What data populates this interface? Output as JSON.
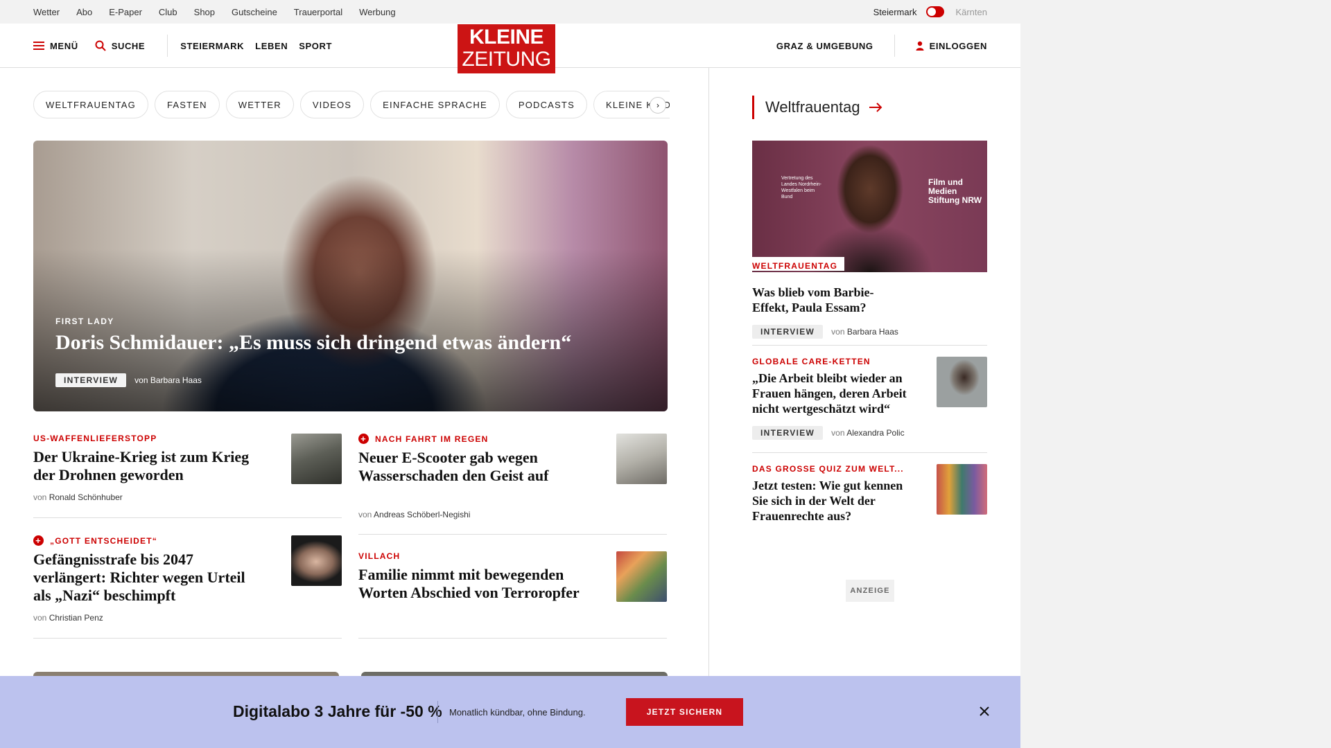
{
  "topbar": {
    "links": [
      "Wetter",
      "Abo",
      "E-Paper",
      "Club",
      "Shop",
      "Gutscheine",
      "Trauerportal",
      "Werbung"
    ],
    "region_active": "Steiermark",
    "region_inactive": "Kärnten"
  },
  "header": {
    "menu_label": "MENÜ",
    "search_label": "SUCHE",
    "nav": [
      "STEIERMARK",
      "LEBEN",
      "SPORT"
    ],
    "logo_line1": "KLEINE",
    "logo_line2": "ZEITUNG",
    "region_link": "GRAZ & UMGEBUNG",
    "login_label": "EINLOGGEN"
  },
  "pills": [
    "WELTFRAUENTAG",
    "FASTEN",
    "WETTER",
    "VIDEOS",
    "EINFACHE SPRACHE",
    "PODCASTS",
    "KLEINE KINDERZE"
  ],
  "hero": {
    "kicker": "FIRST LADY",
    "title": "Doris Schmidauer: „Es muss sich dringend etwas ändern“",
    "badge": "INTERVIEW",
    "by_prefix": "von",
    "author": "Barbara Haas"
  },
  "teasers": [
    {
      "kicker": "US-WAFFENLIEFERSTOPP",
      "title": "Der Ukraine-Krieg ist zum Krieg der Drohnen geworden",
      "by_prefix": "von",
      "author": "Ronald Schönhuber",
      "plus": false
    },
    {
      "kicker": "NACH FAHRT IM REGEN",
      "title": "Neuer E-Scooter gab wegen Wasserschaden den Geist auf",
      "by_prefix": "von",
      "author": "Andreas Schöberl-Negishi",
      "plus": true
    },
    {
      "kicker": "„GOTT ENTSCHEIDET“",
      "title": "Gefängnisstrafe bis 2047 verlängert: Richter wegen Urteil als „Nazi“ beschimpft",
      "by_prefix": "von",
      "author": "Christian Penz",
      "plus": true
    },
    {
      "kicker": "VILLACH",
      "title": "Familie nimmt mit bewegenden Worten Abschied von Terroropfer",
      "by_prefix": "",
      "author": "",
      "plus": false
    }
  ],
  "sidebar": {
    "heading": "Weltfrauentag",
    "image_text_left": "Vertretung des Landes Nordrhein-Westfalen beim Bund",
    "image_text_right": "Film und Medien Stiftung NRW",
    "items": [
      {
        "kicker": "WELTFRAUENTAG",
        "title": "Was blieb vom Barbie-Effekt, Paula Essam?",
        "badge": "INTERVIEW",
        "by_prefix": "von",
        "author": "Barbara Haas"
      },
      {
        "kicker": "GLOBALE CARE-KETTEN",
        "title": "„Die Arbeit bleibt wieder an Frauen hängen, deren Arbeit nicht wertgeschätzt wird“",
        "badge": "INTERVIEW",
        "by_prefix": "von",
        "author": "Alexandra Polic"
      },
      {
        "kicker": "DAS GROSSE QUIZ ZUM WELT...",
        "title": "Jetzt testen: Wie gut kennen Sie sich in der Welt der Frauenrechte aus?"
      }
    ],
    "ad_label": "ANZEIGE"
  },
  "banner": {
    "title": "Digitalabo 3 Jahre für -50 %",
    "subtitle": "Monatlich kündbar, ohne Bindung.",
    "cta": "JETZT SICHERN"
  },
  "colors": {
    "brand_red": "#cc1414",
    "banner_bg": "#bcc2ee"
  }
}
